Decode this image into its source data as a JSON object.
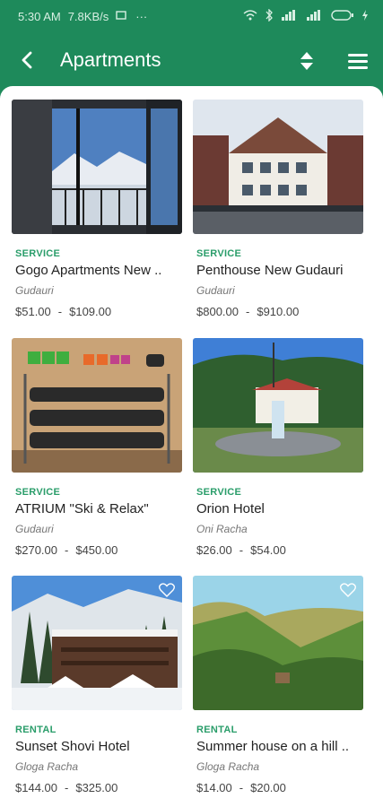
{
  "status_bar": {
    "time": "5:30 AM",
    "speed": "7.8KB/s",
    "more": "···"
  },
  "app_bar": {
    "title": "Apartments",
    "back_icon": "chevron-left-icon",
    "sort_icon": "sort-icon",
    "menu_icon": "hamburger-menu-icon"
  },
  "colors": {
    "primary": "#1e8a5b",
    "category": "#2a9d6a"
  },
  "listings": [
    {
      "category": "SERVICE",
      "name": "Gogo Apartments New ..",
      "location": "Gudauri",
      "price_min": "$51.00",
      "price_sep": "-",
      "price_max": "$109.00"
    },
    {
      "category": "SERVICE",
      "name": "Penthouse New Gudauri",
      "location": "Gudauri",
      "price_min": "$800.00",
      "price_sep": "-",
      "price_max": "$910.00"
    },
    {
      "category": "SERVICE",
      "name": "ATRIUM \"Ski & Relax\"",
      "location": "Gudauri",
      "price_min": "$270.00",
      "price_sep": "-",
      "price_max": "$450.00"
    },
    {
      "category": "SERVICE",
      "name": "Orion Hotel",
      "location": "Oni Racha",
      "price_min": "$26.00",
      "price_sep": "-",
      "price_max": "$54.00"
    },
    {
      "category": "RENTAL",
      "name": "Sunset Shovi Hotel",
      "location": "Gloga Racha",
      "price_min": "$144.00",
      "price_sep": "-",
      "price_max": "$325.00"
    },
    {
      "category": "RENTAL",
      "name": "Summer house on a hill ..",
      "location": "Gloga Racha",
      "price_min": "$14.00",
      "price_sep": "-",
      "price_max": "$20.00"
    }
  ]
}
